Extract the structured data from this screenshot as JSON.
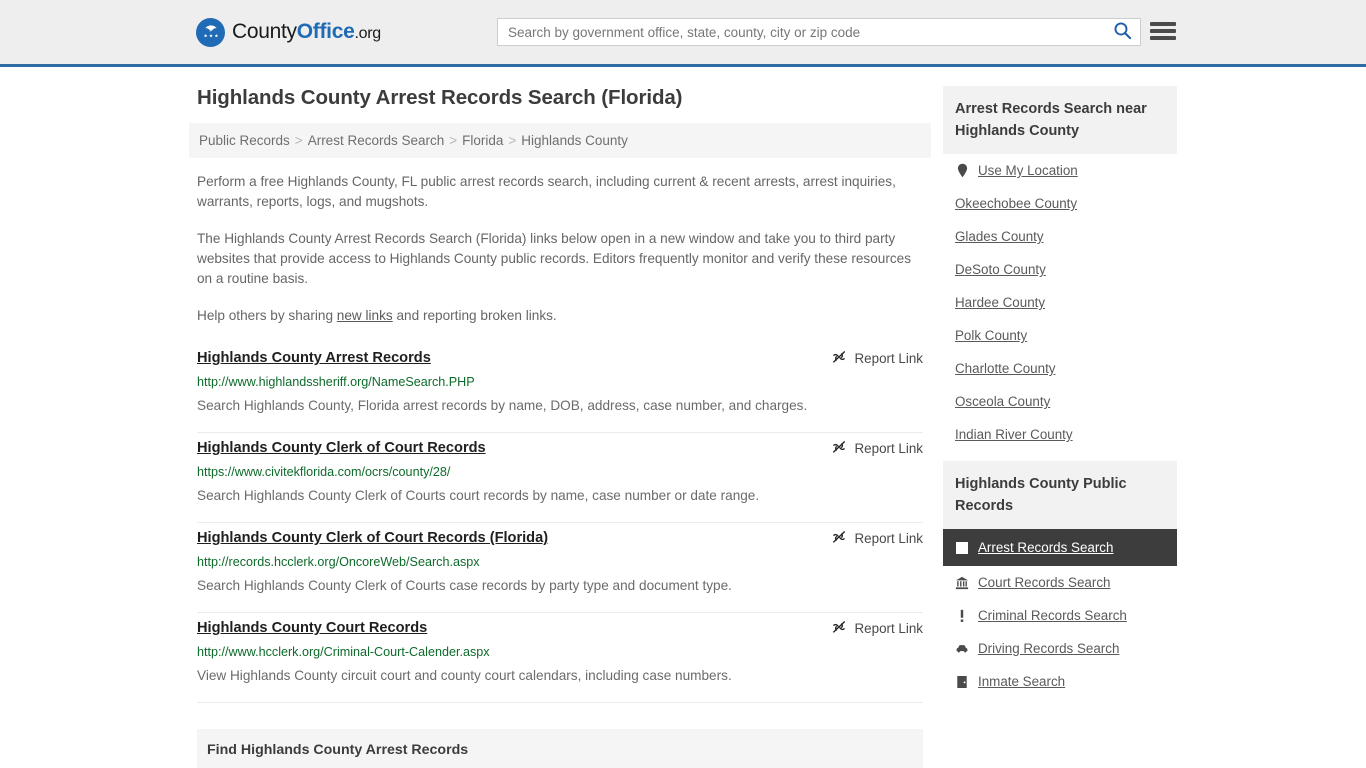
{
  "header": {
    "brand": {
      "part1": "County",
      "part2": "Office",
      "part3": ".org",
      "icon": "eagle-shield-logo"
    },
    "search": {
      "placeholder": "Search by government office, state, county, city or zip code",
      "value": "",
      "icon": "search-icon"
    },
    "menu_icon": "hamburger-menu-icon",
    "accent_color": "#2e6da4",
    "background_color": "#eeeeee"
  },
  "page_title": "Highlands County Arrest Records Search (Florida)",
  "breadcrumb": {
    "separator": ">",
    "items": [
      {
        "label": "Public Records"
      },
      {
        "label": "Arrest Records Search"
      },
      {
        "label": "Florida"
      },
      {
        "label": "Highlands County"
      }
    ]
  },
  "intro": {
    "paragraph1": "Perform a free Highlands County, FL public arrest records search, including current & recent arrests, arrest inquiries, warrants, reports, logs, and mugshots.",
    "paragraph2": "The Highlands County Arrest Records Search (Florida) links below open in a new window and take you to third party websites that provide access to Highlands County public records. Editors frequently monitor and verify these resources on a routine basis.",
    "paragraph3_before": "Help others by sharing ",
    "paragraph3_link": "new links",
    "paragraph3_after": " and reporting broken links."
  },
  "report_link_label": "Report Link",
  "report_link_icon": "broken-link-icon",
  "results": [
    {
      "title": "Highlands County Arrest Records",
      "url": "http://www.highlandssheriff.org/NameSearch.PHP",
      "description": "Search Highlands County, Florida arrest records by name, DOB, address, case number, and charges."
    },
    {
      "title": "Highlands County Clerk of Court Records",
      "url": "https://www.civitekflorida.com/ocrs/county/28/",
      "description": "Search Highlands County Clerk of Courts court records by name, case number or date range."
    },
    {
      "title": "Highlands County Clerk of Court Records (Florida)",
      "url": "http://records.hcclerk.org/OncoreWeb/Search.aspx",
      "description": "Search Highlands County Clerk of Courts case records by party type and document type."
    },
    {
      "title": "Highlands County Court Records",
      "url": "http://www.hcclerk.org/Criminal-Court-Calender.aspx",
      "description": "View Highlands County circuit court and county court calendars, including case numbers."
    }
  ],
  "section_band": {
    "title": "Find Highlands County Arrest Records"
  },
  "sidebar": {
    "near_box": {
      "title": "Arrest Records Search near Highlands County",
      "use_my_location": {
        "label": "Use My Location",
        "icon": "map-pin-icon"
      },
      "counties": [
        {
          "label": "Okeechobee County"
        },
        {
          "label": "Glades County"
        },
        {
          "label": "DeSoto County"
        },
        {
          "label": "Hardee County"
        },
        {
          "label": "Polk County"
        },
        {
          "label": "Charlotte County"
        },
        {
          "label": "Osceola County"
        },
        {
          "label": "Indian River County"
        }
      ]
    },
    "public_records_box": {
      "title": "Highlands County Public Records",
      "items": [
        {
          "label": "Arrest Records Search",
          "icon": "square-icon",
          "active": true
        },
        {
          "label": "Court Records Search",
          "icon": "courthouse-icon",
          "active": false
        },
        {
          "label": "Criminal Records Search",
          "icon": "exclamation-icon",
          "active": false
        },
        {
          "label": "Driving Records Search",
          "icon": "car-icon",
          "active": false
        },
        {
          "label": "Inmate Search",
          "icon": "door-icon",
          "active": false
        }
      ]
    }
  }
}
